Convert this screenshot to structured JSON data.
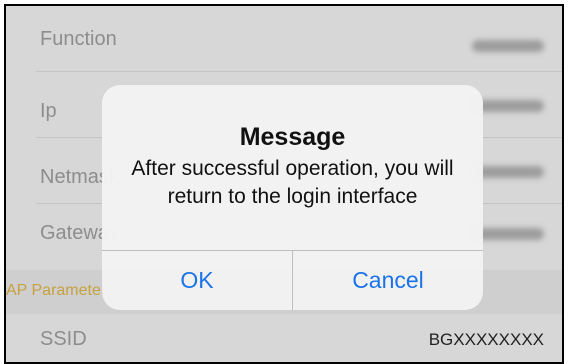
{
  "settings": {
    "rows": [
      {
        "label": "Function"
      },
      {
        "label": "Ip"
      },
      {
        "label": "Netmask"
      },
      {
        "label": "Gateway"
      }
    ],
    "section_header": "AP Parameters",
    "ssid": {
      "label": "SSID",
      "value": "BGXXXXXXXX"
    }
  },
  "dialog": {
    "title": "Message",
    "message": "After successful operation, you will return to the login interface",
    "ok_label": "OK",
    "cancel_label": "Cancel"
  },
  "colors": {
    "accent_blue": "#1a73e8",
    "section_gold": "#c7a13f"
  }
}
